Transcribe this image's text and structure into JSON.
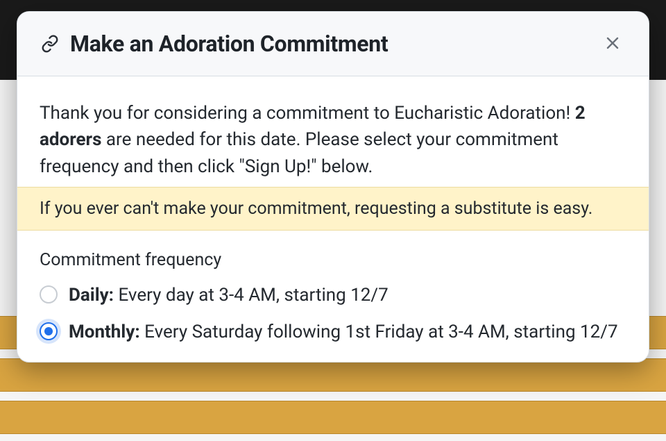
{
  "modal": {
    "title": "Make an Adoration Commitment",
    "intro_prefix": "Thank you for considering a commitment to Eucharistic Adoration! ",
    "intro_bold": "2 adorers",
    "intro_suffix": " are needed for this date. Please select your commitment frequency and then click \"Sign Up!\" below.",
    "banner": "If you ever can't make your commitment, requesting a substitute is easy.",
    "frequency_label": "Commitment frequency",
    "options": [
      {
        "name": "Daily:",
        "desc": " Every day at 3-4 AM, starting 12/7",
        "selected": false
      },
      {
        "name": "Monthly:",
        "desc": " Every Saturday following 1st Friday at 3-4 AM, starting 12/7",
        "selected": true
      }
    ]
  }
}
